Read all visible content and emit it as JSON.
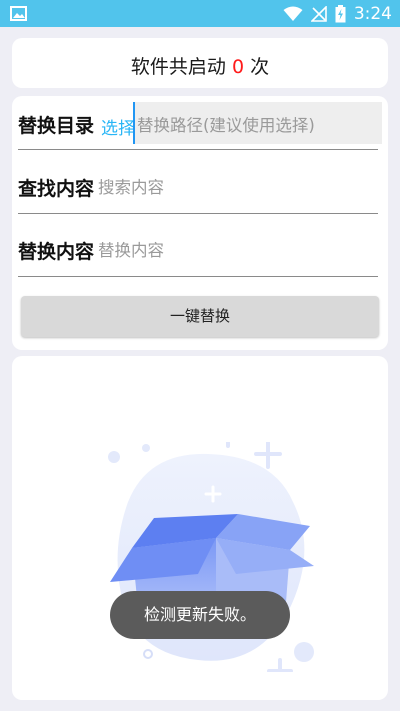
{
  "status_bar": {
    "time": "3:24",
    "left_icon": "image-icon",
    "icons": [
      "wifi-icon",
      "signal-off-icon",
      "battery-charging-icon"
    ],
    "color": "#51c4ec"
  },
  "header": {
    "prefix": "软件共启动",
    "count": "0",
    "suffix": "次",
    "count_color": "#ff1a1a"
  },
  "form": {
    "dir_label": "替换目录",
    "choose_label": "选择",
    "path_placeholder": "替换路径(建议使用选择)",
    "find_label": "查找内容",
    "find_placeholder": "搜索内容",
    "replace_label": "替换内容",
    "replace_placeholder": "替换内容",
    "button_label": "一键替换"
  },
  "result": {
    "illustration": "empty-box-icon"
  },
  "toast": {
    "text": "检测更新失败。"
  }
}
